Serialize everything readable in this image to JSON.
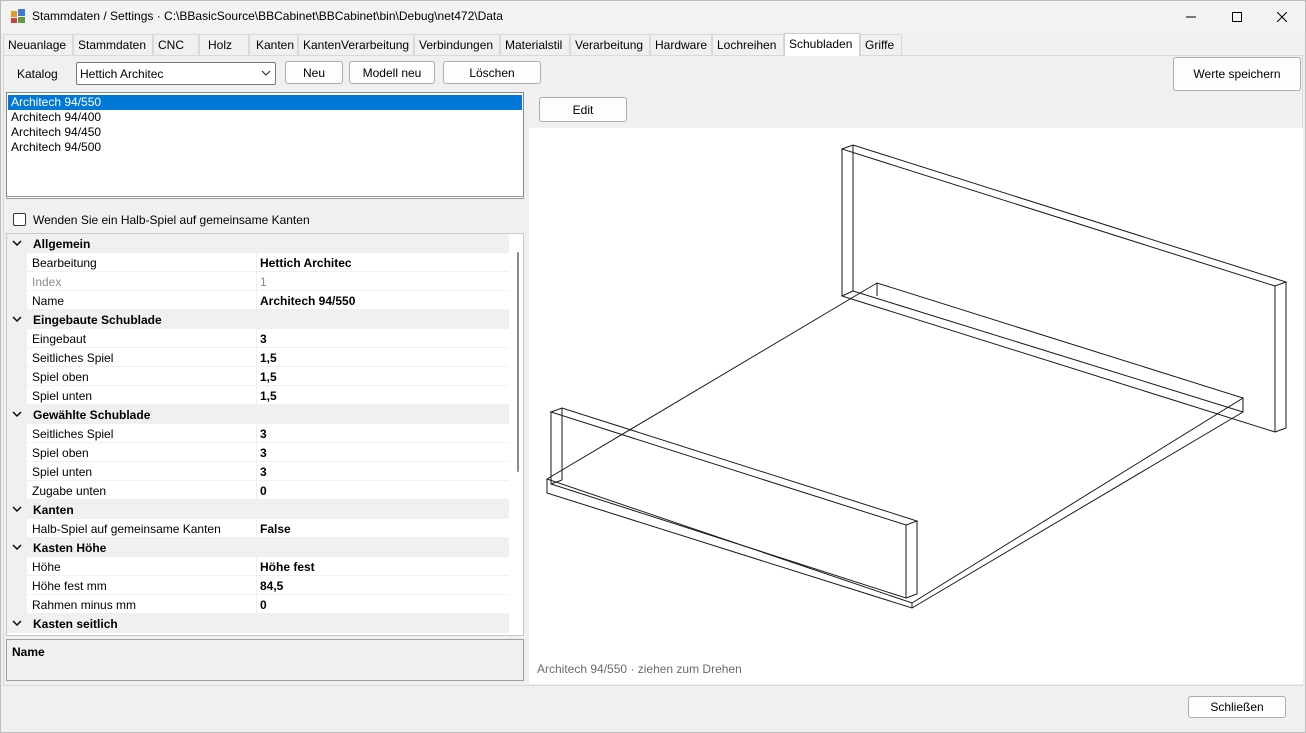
{
  "window": {
    "title": "Stammdaten / Settings  ·  C:\\BBasicSource\\BBCabinet\\BBCabinet\\bin\\Debug\\net472\\Data"
  },
  "tabs": [
    {
      "label": "Neuanlage"
    },
    {
      "label": "Stammdaten"
    },
    {
      "label": "CNC"
    },
    {
      "label": "Holz"
    },
    {
      "label": "Kanten"
    },
    {
      "label": "KantenVerarbeitung"
    },
    {
      "label": "Verbindungen"
    },
    {
      "label": "Materialstil"
    },
    {
      "label": "Verarbeitung"
    },
    {
      "label": "Hardware"
    },
    {
      "label": "Lochreihen"
    },
    {
      "label": "Schubladen"
    },
    {
      "label": "Griffe"
    }
  ],
  "active_tab": "Schubladen",
  "toolbar": {
    "katalog_label": "Katalog",
    "katalog_value": "Hettich Architec",
    "neu_label": "Neu",
    "modell_neu_label": "Modell neu",
    "loeschen_label": "Löschen",
    "save_label": "Werte speichern",
    "edit_label": "Edit"
  },
  "models": [
    {
      "label": "Architech 94/550",
      "selected": true
    },
    {
      "label": "Architech 94/400",
      "selected": false
    },
    {
      "label": "Architech 94/450",
      "selected": false
    },
    {
      "label": "Architech 94/500",
      "selected": false
    }
  ],
  "halb_spiel_checkbox": {
    "label": "Wenden Sie ein Halb-Spiel auf gemeinsame Kanten",
    "checked": false
  },
  "property_grid": {
    "categories": [
      {
        "name": "Allgemein",
        "props": [
          {
            "name": "Bearbeitung",
            "value": "Hettich Architec",
            "disabled": false
          },
          {
            "name": "Index",
            "value": "1",
            "disabled": true
          },
          {
            "name": "Name",
            "value": "Architech 94/550",
            "disabled": false
          }
        ]
      },
      {
        "name": "Eingebaute Schublade",
        "props": [
          {
            "name": "Eingebaut",
            "value": "3",
            "disabled": false
          },
          {
            "name": "Seitliches Spiel",
            "value": "1,5",
            "disabled": false
          },
          {
            "name": "Spiel oben",
            "value": "1,5",
            "disabled": false
          },
          {
            "name": "Spiel unten",
            "value": "1,5",
            "disabled": false
          }
        ]
      },
      {
        "name": "Gewählte Schublade",
        "props": [
          {
            "name": "Seitliches Spiel",
            "value": "3",
            "disabled": false
          },
          {
            "name": "Spiel oben",
            "value": "3",
            "disabled": false
          },
          {
            "name": "Spiel unten",
            "value": "3",
            "disabled": false
          },
          {
            "name": "Zugabe unten",
            "value": "0",
            "disabled": false
          }
        ]
      },
      {
        "name": "Kanten",
        "props": [
          {
            "name": "Halb-Spiel auf gemeinsame Kanten",
            "value": "False",
            "disabled": false
          }
        ]
      },
      {
        "name": "Kasten Höhe",
        "props": [
          {
            "name": "Höhe",
            "value": "Höhe fest",
            "disabled": false
          },
          {
            "name": "Höhe fest mm",
            "value": "84,5",
            "disabled": false
          },
          {
            "name": "Rahmen minus mm",
            "value": "0",
            "disabled": false
          }
        ]
      },
      {
        "name": "Kasten seitlich",
        "props": []
      }
    ],
    "help_title": "Name"
  },
  "viewport": {
    "caption": "Architech 94/550  ·  ziehen zum Drehen"
  },
  "footer": {
    "close_label": "Schließen"
  },
  "colors": {
    "selection": "#0078d7",
    "window_bg": "#f0f0f0"
  }
}
